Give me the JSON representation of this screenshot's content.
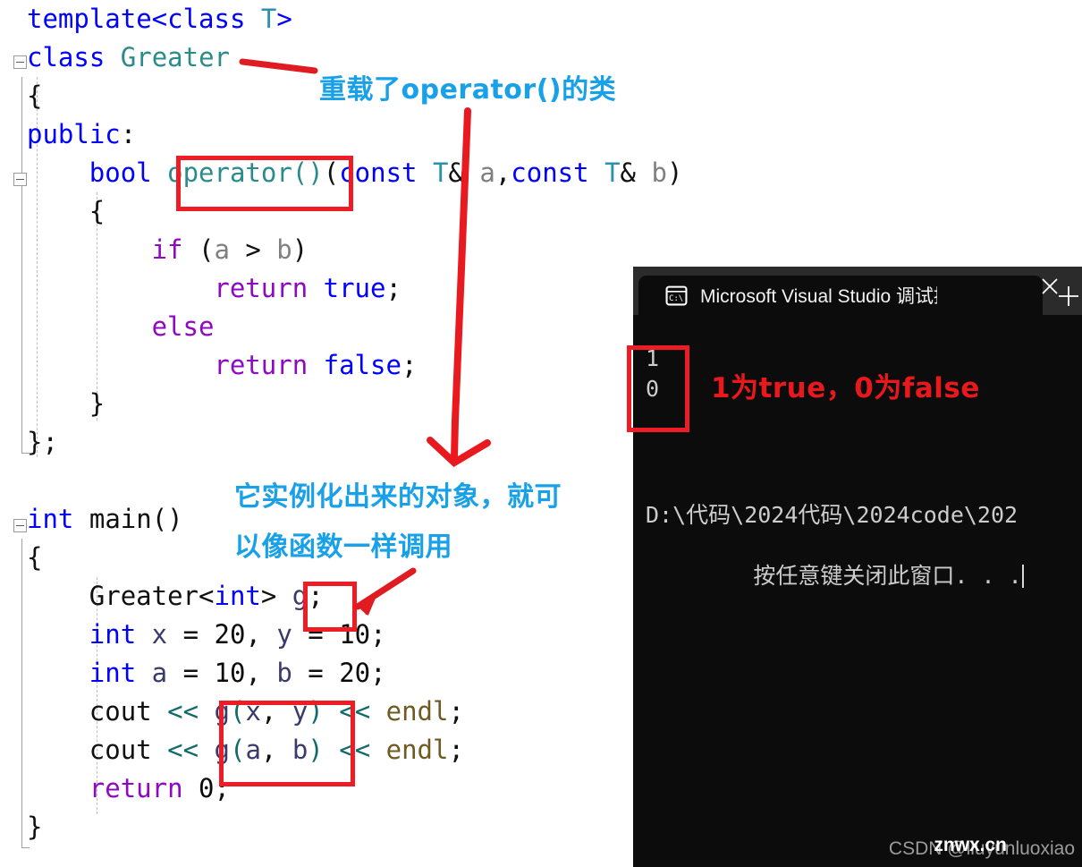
{
  "editor": {
    "name": "visual-studio-code-editor",
    "lines": [
      {
        "indent": 0,
        "tokens": [
          {
            "t": "template<",
            "c": "t-kw"
          },
          {
            "t": "class",
            "c": "t-kw"
          },
          {
            "t": " ",
            "c": "t-plain"
          },
          {
            "t": "T",
            "c": "t-type"
          },
          {
            "t": ">",
            "c": "t-kw"
          }
        ]
      },
      {
        "indent": 0,
        "tokens": [
          {
            "t": "class",
            "c": "t-kw"
          },
          {
            "t": " ",
            "c": "t-plain"
          },
          {
            "t": "Greater",
            "c": "t-cls"
          }
        ]
      },
      {
        "indent": 0,
        "tokens": [
          {
            "t": "{",
            "c": "t-plain"
          }
        ]
      },
      {
        "indent": 0,
        "tokens": [
          {
            "t": "public",
            "c": "t-kw"
          },
          {
            "t": ":",
            "c": "t-plain"
          }
        ]
      },
      {
        "indent": 1,
        "tokens": [
          {
            "t": "bool",
            "c": "t-kw"
          },
          {
            "t": " ",
            "c": "t-plain"
          },
          {
            "t": "operator()",
            "c": "t-cls"
          },
          {
            "t": "(",
            "c": "t-plain"
          },
          {
            "t": "const",
            "c": "t-kw"
          },
          {
            "t": " ",
            "c": "t-plain"
          },
          {
            "t": "T",
            "c": "t-type"
          },
          {
            "t": "& ",
            "c": "t-plain"
          },
          {
            "t": "a",
            "c": "t-var"
          },
          {
            "t": ",",
            "c": "t-plain"
          },
          {
            "t": "const",
            "c": "t-kw"
          },
          {
            "t": " ",
            "c": "t-plain"
          },
          {
            "t": "T",
            "c": "t-type"
          },
          {
            "t": "& ",
            "c": "t-plain"
          },
          {
            "t": "b",
            "c": "t-var"
          },
          {
            "t": ")",
            "c": "t-plain"
          }
        ]
      },
      {
        "indent": 1,
        "tokens": [
          {
            "t": "{",
            "c": "t-plain"
          }
        ]
      },
      {
        "indent": 2,
        "tokens": [
          {
            "t": "if",
            "c": "t-ctl"
          },
          {
            "t": " (",
            "c": "t-plain"
          },
          {
            "t": "a",
            "c": "t-var"
          },
          {
            "t": " > ",
            "c": "t-plain"
          },
          {
            "t": "b",
            "c": "t-var"
          },
          {
            "t": ")",
            "c": "t-plain"
          }
        ]
      },
      {
        "indent": 3,
        "tokens": [
          {
            "t": "return",
            "c": "t-ctl"
          },
          {
            "t": " ",
            "c": "t-plain"
          },
          {
            "t": "true",
            "c": "t-kw"
          },
          {
            "t": ";",
            "c": "t-plain"
          }
        ]
      },
      {
        "indent": 2,
        "tokens": [
          {
            "t": "else",
            "c": "t-ctl"
          }
        ]
      },
      {
        "indent": 3,
        "tokens": [
          {
            "t": "return",
            "c": "t-ctl"
          },
          {
            "t": " ",
            "c": "t-plain"
          },
          {
            "t": "false",
            "c": "t-kw"
          },
          {
            "t": ";",
            "c": "t-plain"
          }
        ]
      },
      {
        "indent": 1,
        "tokens": [
          {
            "t": "}",
            "c": "t-plain"
          }
        ]
      },
      {
        "indent": 0,
        "tokens": [
          {
            "t": "};",
            "c": "t-plain"
          }
        ]
      },
      {
        "indent": 0,
        "tokens": [
          {
            "t": " ",
            "c": "t-plain"
          }
        ]
      },
      {
        "indent": 0,
        "tokens": [
          {
            "t": "int",
            "c": "t-kw"
          },
          {
            "t": " ",
            "c": "t-plain"
          },
          {
            "t": "main",
            "c": "t-plain"
          },
          {
            "t": "()",
            "c": "t-plain"
          }
        ]
      },
      {
        "indent": 0,
        "tokens": [
          {
            "t": "{",
            "c": "t-plain"
          }
        ]
      },
      {
        "indent": 1,
        "tokens": [
          {
            "t": "Greater",
            "c": "t-plain"
          },
          {
            "t": "<",
            "c": "t-plain"
          },
          {
            "t": "int",
            "c": "t-kw"
          },
          {
            "t": "> ",
            "c": "t-plain"
          },
          {
            "t": "g",
            "c": "t-id"
          },
          {
            "t": ";",
            "c": "t-plain"
          }
        ]
      },
      {
        "indent": 1,
        "tokens": [
          {
            "t": "int",
            "c": "t-kw"
          },
          {
            "t": " ",
            "c": "t-plain"
          },
          {
            "t": "x",
            "c": "t-id"
          },
          {
            "t": " = ",
            "c": "t-plain"
          },
          {
            "t": "20",
            "c": "t-num"
          },
          {
            "t": ", ",
            "c": "t-plain"
          },
          {
            "t": "y",
            "c": "t-id"
          },
          {
            "t": " = ",
            "c": "t-plain"
          },
          {
            "t": "10",
            "c": "t-num"
          },
          {
            "t": ";",
            "c": "t-plain"
          }
        ]
      },
      {
        "indent": 1,
        "tokens": [
          {
            "t": "int",
            "c": "t-kw"
          },
          {
            "t": " ",
            "c": "t-plain"
          },
          {
            "t": "a",
            "c": "t-id"
          },
          {
            "t": " = ",
            "c": "t-plain"
          },
          {
            "t": "10",
            "c": "t-num"
          },
          {
            "t": ", ",
            "c": "t-plain"
          },
          {
            "t": "b",
            "c": "t-id"
          },
          {
            "t": " = ",
            "c": "t-plain"
          },
          {
            "t": "20",
            "c": "t-num"
          },
          {
            "t": ";",
            "c": "t-plain"
          }
        ]
      },
      {
        "indent": 1,
        "tokens": [
          {
            "t": "cout",
            "c": "t-plain"
          },
          {
            "t": " ",
            "c": "t-plain"
          },
          {
            "t": "<<",
            "c": "t-op"
          },
          {
            "t": " ",
            "c": "t-plain"
          },
          {
            "t": "g",
            "c": "t-id"
          },
          {
            "t": "(",
            "c": "t-op"
          },
          {
            "t": "x",
            "c": "t-id"
          },
          {
            "t": ", ",
            "c": "t-plain"
          },
          {
            "t": "y",
            "c": "t-id"
          },
          {
            "t": ")",
            "c": "t-op"
          },
          {
            "t": " ",
            "c": "t-plain"
          },
          {
            "t": "<<",
            "c": "t-op"
          },
          {
            "t": " ",
            "c": "t-plain"
          },
          {
            "t": "endl",
            "c": "t-std"
          },
          {
            "t": ";",
            "c": "t-plain"
          }
        ]
      },
      {
        "indent": 1,
        "tokens": [
          {
            "t": "cout",
            "c": "t-plain"
          },
          {
            "t": " ",
            "c": "t-plain"
          },
          {
            "t": "<<",
            "c": "t-op"
          },
          {
            "t": " ",
            "c": "t-plain"
          },
          {
            "t": "g",
            "c": "t-id"
          },
          {
            "t": "(",
            "c": "t-op"
          },
          {
            "t": "a",
            "c": "t-id"
          },
          {
            "t": ", ",
            "c": "t-plain"
          },
          {
            "t": "b",
            "c": "t-id"
          },
          {
            "t": ")",
            "c": "t-op"
          },
          {
            "t": " ",
            "c": "t-plain"
          },
          {
            "t": "<<",
            "c": "t-op"
          },
          {
            "t": " ",
            "c": "t-plain"
          },
          {
            "t": "endl",
            "c": "t-std"
          },
          {
            "t": ";",
            "c": "t-plain"
          }
        ]
      },
      {
        "indent": 1,
        "tokens": [
          {
            "t": "return",
            "c": "t-ctl"
          },
          {
            "t": " ",
            "c": "t-plain"
          },
          {
            "t": "0",
            "c": "t-num"
          },
          {
            "t": ";",
            "c": "t-plain"
          }
        ]
      },
      {
        "indent": 0,
        "tokens": [
          {
            "t": "}",
            "c": "t-plain"
          }
        ]
      }
    ],
    "plain_lines": [
      "template<class T>",
      "class Greater",
      "{",
      "public:",
      "    bool operator()(const T& a,const T& b)",
      "    {",
      "        if (a > b)",
      "            return true;",
      "        else",
      "            return false;",
      "    }",
      "};",
      "",
      "int main()",
      "{",
      "    Greater<int> g;",
      "    int x = 20, y = 10;",
      "    int a = 10, b = 20;",
      "    cout << g(x, y) << endl;",
      "    cout << g(a, b) << endl;",
      "    return 0;",
      "}"
    ]
  },
  "annotations": {
    "anno1": "重载了operator()的类",
    "anno2_line1": "它实例化出来的对象，就可",
    "anno2_line2": "以像函数一样调用",
    "anno3": "1为true，0为false",
    "color_cyan": "#18a0e8",
    "color_red": "#e8181c",
    "box_color": "#ee1c25"
  },
  "terminal": {
    "tab_title": "Microsoft Visual Studio 调试控",
    "tab_icon": "console-icon",
    "close_label": "✕",
    "newtab_label": "+",
    "output_line1": "1",
    "output_line2": "0",
    "path_line": "D:\\代码\\2024代码\\2024code\\202",
    "prompt_line": "按任意键关闭此窗口. . ."
  },
  "watermark": {
    "csdn": "CSDN @liuyunluoxiao",
    "site": "znwx.cn"
  }
}
